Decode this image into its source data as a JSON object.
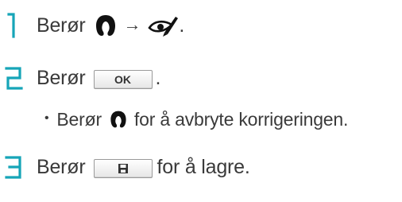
{
  "steps": [
    {
      "number": "1",
      "parts": {
        "verb": "Berør",
        "arrow": "→",
        "end": "."
      },
      "icons": [
        "magnet-handle-icon",
        "eye-pen-icon"
      ]
    },
    {
      "number": "2",
      "parts": {
        "verb": "Berør",
        "button_label": "OK",
        "end": "."
      },
      "sub": {
        "bullet": "•",
        "before": "Berør",
        "after": "for å avbryte korrigeringen."
      },
      "icons": [
        "magnet-handle-icon"
      ]
    },
    {
      "number": "3",
      "parts": {
        "verb": "Berør",
        "after": "for å lagre."
      },
      "icons": [
        "save-icon"
      ]
    }
  ],
  "colors": {
    "accent": "#16a5b8",
    "text": "#3a3a3a"
  }
}
